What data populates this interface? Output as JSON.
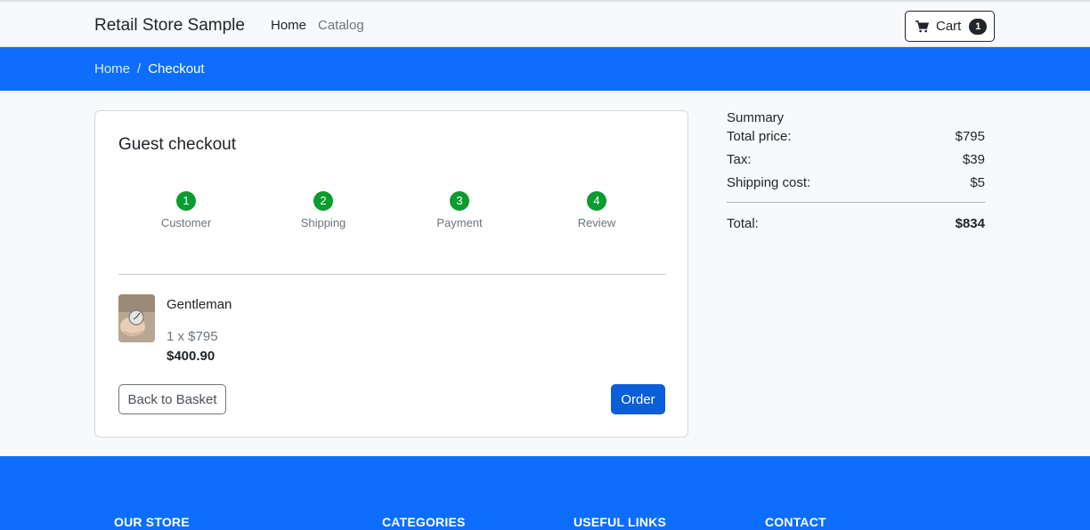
{
  "navbar": {
    "brand": "Retail Store Sample",
    "links": [
      "Home",
      "Catalog"
    ],
    "cart": {
      "label": "Cart",
      "count": "1"
    }
  },
  "breadcrumb": {
    "items": [
      "Home",
      "Checkout"
    ],
    "separator": "/"
  },
  "checkout": {
    "title": "Guest checkout",
    "steps": [
      {
        "number": "1",
        "label": "Customer"
      },
      {
        "number": "2",
        "label": "Shipping"
      },
      {
        "number": "3",
        "label": "Payment"
      },
      {
        "number": "4",
        "label": "Review"
      }
    ],
    "item": {
      "name": "Gentleman",
      "quantity_price": "1 x $795",
      "total": "$400.90",
      "thumbnail": "watch-in-hand-image"
    },
    "back_label": "Back to Basket",
    "order_label": "Order"
  },
  "summary": {
    "title": "Summary",
    "rows": [
      {
        "label": "Total price:",
        "value": "$795"
      },
      {
        "label": "Tax:",
        "value": "$39"
      },
      {
        "label": "Shipping cost:",
        "value": "$5"
      }
    ],
    "total": {
      "label": "Total:",
      "value": "$834"
    }
  },
  "footer": {
    "headings": [
      "OUR STORE",
      "CATEGORIES",
      "USEFUL LINKS",
      "CONTACT"
    ]
  },
  "colors": {
    "primary": "#0d6efd",
    "step": "#0a9c2e",
    "order_button": "#0b5ed7"
  }
}
